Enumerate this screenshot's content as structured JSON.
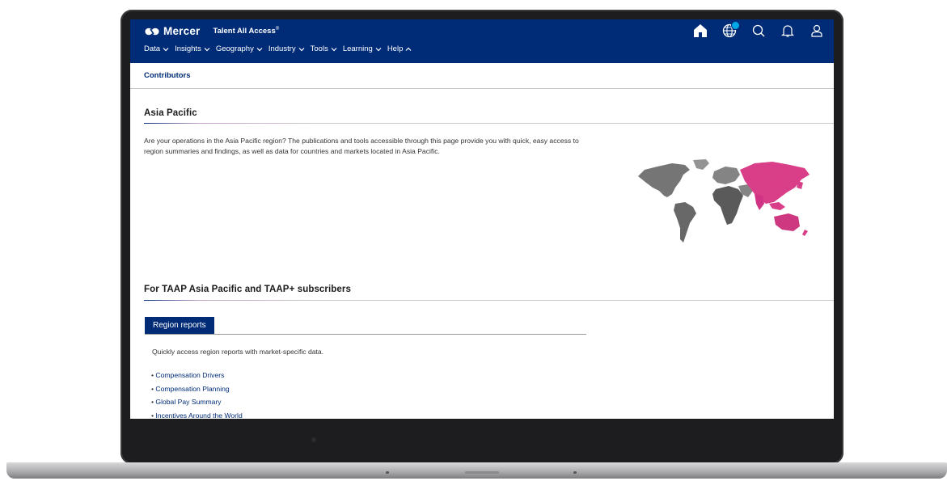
{
  "header": {
    "brand": "Mercer",
    "product": "Talent All Access",
    "product_mark": "®",
    "nav": [
      {
        "label": "Data",
        "chevron": "down"
      },
      {
        "label": "Insights",
        "chevron": "down"
      },
      {
        "label": "Geography",
        "chevron": "down"
      },
      {
        "label": "Industry",
        "chevron": "down"
      },
      {
        "label": "Tools",
        "chevron": "down"
      },
      {
        "label": "Learning",
        "chevron": "down"
      },
      {
        "label": "Help",
        "chevron": "up"
      }
    ],
    "icons": [
      "home-icon",
      "globe-icon",
      "search-icon",
      "bell-icon",
      "user-icon"
    ],
    "accent": "#002c77",
    "badge_color": "#00a8e8"
  },
  "subnav": {
    "title": "Contributors"
  },
  "section1": {
    "heading": "Asia Pacific",
    "intro": "Are your operations in the Asia Pacific region? The publications and tools accessible through this page provide you with quick, easy access to region summaries and findings, as well as data for countries and markets located in Asia Pacific."
  },
  "map": {
    "highlight_color": "#e2418f",
    "base_color": "#8a8a8a"
  },
  "section2": {
    "heading": "For TAAP Asia Pacific and TAAP+ subscribers",
    "tab_label": "Region reports",
    "description": "Quickly access region reports with market-specific data.",
    "reports": [
      "Compensation Drivers",
      "Compensation Planning",
      "Global Pay Summary",
      "Incentives Around the World"
    ]
  }
}
